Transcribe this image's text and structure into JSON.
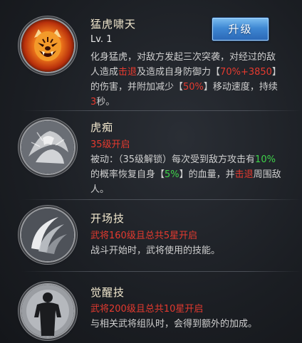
{
  "skills": [
    {
      "name": "猛虎啸天",
      "level": "Lv. 1",
      "desc": [
        {
          "t": "化身猛虎，对敌方发起三次突袭，对经过的敌人造成",
          "c": ""
        },
        {
          "t": "击退",
          "c": "red"
        },
        {
          "t": "及造成自身防御力【",
          "c": ""
        },
        {
          "t": "70%+3850",
          "c": "red"
        },
        {
          "t": "】的伤害，并附加减少【",
          "c": ""
        },
        {
          "t": "50%",
          "c": "red"
        },
        {
          "t": "】移动速度，持续",
          "c": ""
        },
        {
          "t": "3",
          "c": "red"
        },
        {
          "t": "秒。",
          "c": ""
        }
      ],
      "icon": "tiger-head-icon"
    },
    {
      "name": "虎痴",
      "unlock": "35级开启",
      "desc": [
        {
          "t": "被动：（35级解锁）每次受到敌方攻击有",
          "c": ""
        },
        {
          "t": "10%",
          "c": "green"
        },
        {
          "t": "的概率恢复自身【",
          "c": ""
        },
        {
          "t": "5%",
          "c": "green"
        },
        {
          "t": "】的血量，并",
          "c": ""
        },
        {
          "t": "击退",
          "c": "red"
        },
        {
          "t": "周围敌人。",
          "c": ""
        }
      ],
      "icon": "fury-warrior-icon"
    },
    {
      "name": "开场技",
      "unlock": "武将160级且总共5星开启",
      "desc": [
        {
          "t": "战斗开始时，武将使用的技能。",
          "c": ""
        }
      ],
      "icon": "slash-arc-icon"
    },
    {
      "name": "觉醒技",
      "unlock": "武将200级且总共10星开启",
      "desc": [
        {
          "t": "与相关武将组队时，会得到额外的加成。",
          "c": ""
        }
      ],
      "icon": "awakened-silhouette-icon"
    }
  ],
  "upgrade_button": {
    "label": "升级"
  },
  "colors": {
    "red": "#e53a2f",
    "green": "#3fd44a",
    "button": "#3f88d3"
  }
}
